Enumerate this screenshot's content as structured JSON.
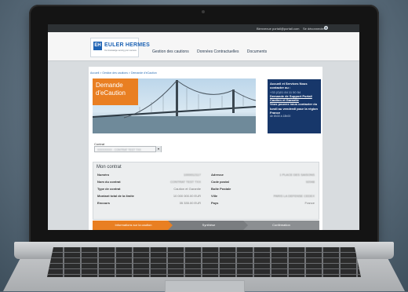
{
  "topbar": {
    "user_label": "Bienvenue portail@portail.com",
    "logout_label": "Se déconnecter",
    "gear_icon": "gear-icon"
  },
  "logo": {
    "mark": "EH",
    "name": "EULER HERMES",
    "tagline": "Our knowledge serving your success"
  },
  "nav": {
    "items": [
      "Gestion des cautions",
      "Données Contractuelles",
      "Documents"
    ]
  },
  "breadcrumb": "Accueil > Gestion des cautions > Demande d'eCaution",
  "hero": {
    "title_line1": "Demande",
    "title_line2": "d'eCaution"
  },
  "contact": {
    "title": "Accueil et Services Nous contacter au :",
    "phone": "+33 (0)01 84 11 50 54",
    "support_link": "Demande de Support Portail Caution et Garantie",
    "hours_intro": "Vous pouvez nous contacter du lundi au vendredi pour la région France",
    "hours": "de 8h30 à 18h00"
  },
  "contrat": {
    "label": "Contrat",
    "selected_value": "XXXXXXXX - CONTRAT TEST TXX"
  },
  "mon_contrat": {
    "title": "Mon contrat",
    "rows": [
      {
        "label_left": "Numéro",
        "value_left": "1000012117",
        "label_right": "Adresse",
        "value_right": "1 PLACE DES SAISONS"
      },
      {
        "label_left": "Nom du contrat",
        "value_left": "CONTRAT TEST TXX",
        "label_right": "Code postal",
        "value_right": "92048"
      },
      {
        "label_left": "Type de contrat",
        "value_left": "Caution et Garantie",
        "label_right": "Boîte Postale",
        "value_right": ""
      },
      {
        "label_left": "Montant total de la limite",
        "value_left": "10 000 000.00 EUR",
        "label_right": "Ville",
        "value_right": "PARIS LA DEFENSE CEDEX"
      },
      {
        "label_left": "Encours",
        "value_left": "35 335.00 EUR",
        "label_right": "Pays",
        "value_right": "France"
      }
    ]
  },
  "steps": [
    "Informations sur la caution",
    "Synthèse",
    "Confirmation"
  ]
}
